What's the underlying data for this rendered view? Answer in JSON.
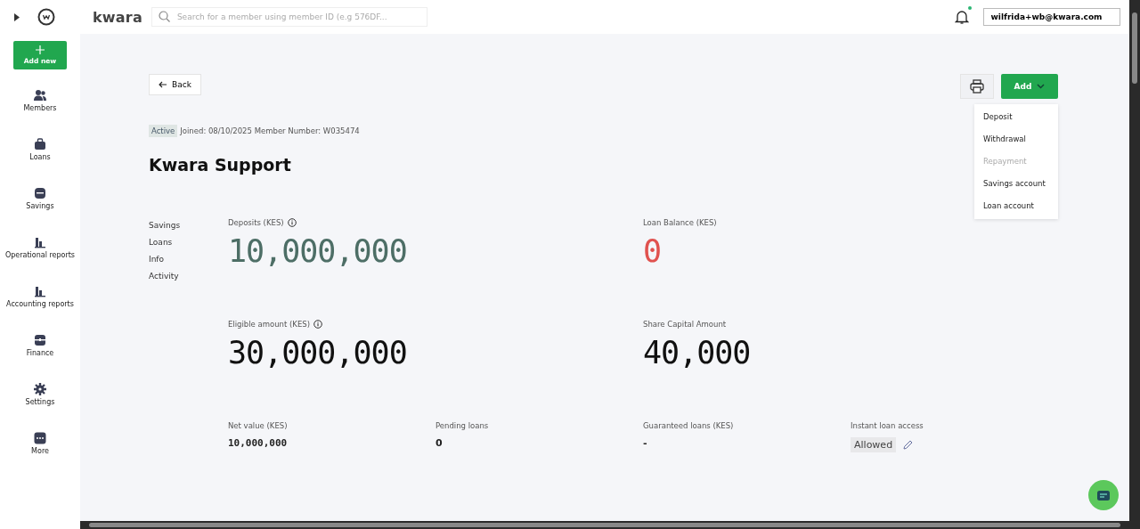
{
  "brand": "kwara",
  "search": {
    "placeholder": "Search for a member using member ID (e.g 576DF..."
  },
  "notifications": {
    "unread": true
  },
  "user": {
    "email": "wilfrida+wb@kwara.com"
  },
  "sidebar": {
    "add_button": "Add new",
    "items": [
      {
        "label": "Members"
      },
      {
        "label": "Loans"
      },
      {
        "label": "Savings"
      },
      {
        "label": "Operational reports"
      },
      {
        "label": "Accounting reports"
      },
      {
        "label": "Finance"
      },
      {
        "label": "Settings"
      },
      {
        "label": "More"
      }
    ]
  },
  "back_button": "Back",
  "add_button": "Add",
  "add_menu": [
    {
      "label": "Deposit",
      "disabled": false
    },
    {
      "label": "Withdrawal",
      "disabled": false
    },
    {
      "label": "Repayment",
      "disabled": true
    },
    {
      "label": "Savings account",
      "disabled": false
    },
    {
      "label": "Loan account",
      "disabled": false
    }
  ],
  "member": {
    "status": "Active",
    "meta": "Joined: 08/10/2025 Member Number: W035474",
    "name": "Kwara Support"
  },
  "section_nav": [
    "Savings",
    "Loans",
    "Info",
    "Activity"
  ],
  "big_stats": [
    {
      "label": "Deposits (KES)",
      "info": true,
      "value": "10,000,000",
      "color": "#4d6e66"
    },
    {
      "label": "Loan Balance (KES)",
      "info": false,
      "value": "0",
      "color": "#e0524f"
    },
    {
      "label": "Eligible amount (KES)",
      "info": true,
      "value": "30,000,000",
      "color": "#111111"
    },
    {
      "label": "Share Capital Amount",
      "info": false,
      "value": "40,000",
      "color": "#111111"
    }
  ],
  "small_stats": [
    {
      "label": "Net value (KES)",
      "value": "10,000,000",
      "kind": "mono"
    },
    {
      "label": "Pending loans",
      "value": "0",
      "kind": "plain"
    },
    {
      "label": "Guaranteed loans (KES)",
      "value": "-",
      "kind": "plain"
    },
    {
      "label": "Instant loan access",
      "value": "Allowed",
      "kind": "pill"
    }
  ]
}
